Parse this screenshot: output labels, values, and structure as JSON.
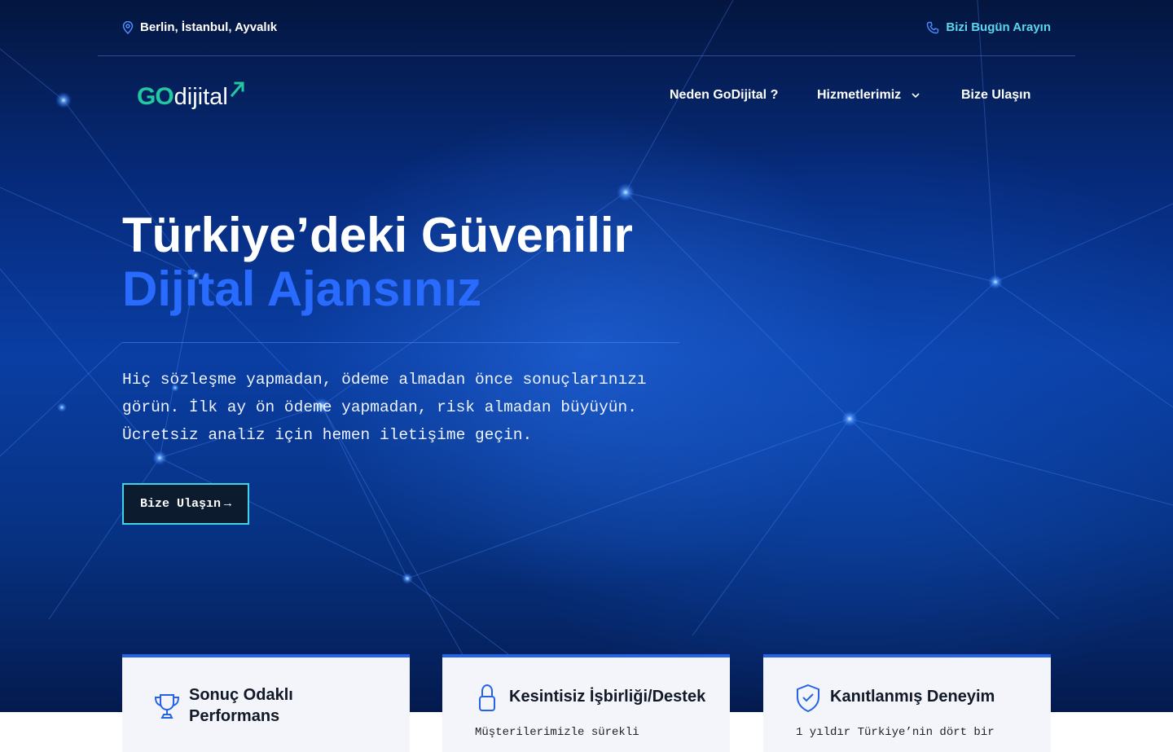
{
  "topbar": {
    "location": "Berlin, İstanbul, Ayvalık",
    "phone_label": "Bizi Bugün Arayın"
  },
  "logo": {
    "go": "GO",
    "text": "dijital"
  },
  "nav": {
    "items": [
      {
        "label": "Neden GoDijital ?"
      },
      {
        "label": "Hizmetlerimiz"
      },
      {
        "label": "Bize Ulaşın"
      }
    ]
  },
  "hero": {
    "title_line1": "Türkiye’deki Güvenilir",
    "title_line2": "Dijital Ajansınız",
    "subtitle": "Hiç sözleşme yapmadan, ödeme almadan önce sonuçlarınızı görün. İlk ay ön ödeme yapmadan, risk almadan büyüyün. Ücretsiz analiz için hemen iletişime geçin.",
    "cta_label": "Bize Ulaşın",
    "cta_arrow": "→"
  },
  "features": [
    {
      "title": "Sonuç Odaklı Performans",
      "icon": "trophy-icon",
      "desc": ""
    },
    {
      "title": "Kesintisiz İşbirliği/Destek",
      "icon": "lock-icon",
      "desc": "Müşterilerimizle sürekli"
    },
    {
      "title": "Kanıtlanmış Deneyim",
      "icon": "shield-check-icon",
      "desc": "1 yıldır Türkiye’nin dört bir"
    }
  ],
  "colors": {
    "accent": "#2a6bff",
    "cyan": "#40d2e6",
    "card_bar": "#2463e6"
  }
}
